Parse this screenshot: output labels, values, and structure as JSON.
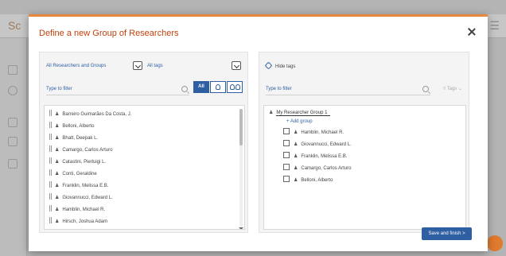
{
  "background": {
    "logo_text": "Sc",
    "menu_icon": "hamburger-icon"
  },
  "modal": {
    "title": "Define a new Group of Researchers",
    "close_icon": "close-icon"
  },
  "left_panel": {
    "group_filter": {
      "selected": "All Researchers and Groups"
    },
    "tag_filter": {
      "selected": "All tags"
    },
    "filter": {
      "placeholder": "Type to filter",
      "value": "Type to filter"
    },
    "toggle_buttons": [
      {
        "label": "All",
        "icon": "",
        "active": true
      },
      {
        "label": "",
        "icon": "person-icon",
        "active": false
      },
      {
        "label": "",
        "icon": "group-icon",
        "active": false
      }
    ],
    "researchers": [
      "Barreiro Guimarães Da Costa, J.",
      "Belloni, Alberto",
      "Bhatt, Deepak L.",
      "Camargo, Carlos Arturo",
      "Catastini, Pierluigi L.",
      "Conti, Geraldine",
      "Franklin, Melissa E.B.",
      "Giovannucci, Edward L.",
      "Hamblin, Michael R.",
      "Hirsch, Joshua Adam"
    ]
  },
  "right_panel": {
    "hide_tags_label": "Hide tags",
    "filter": {
      "placeholder": "Type to filter",
      "value": "Type to filter"
    },
    "tags_label": "Tags",
    "group": {
      "name": "My Researcher Group 1",
      "add_group_label": "+ Add group",
      "members": [
        "Hamblin, Michael R.",
        "Giovannucci, Edward L.",
        "Franklin, Melissa E.B.",
        "Camargo, Carlos Arturo",
        "Belloni, Alberto"
      ]
    }
  },
  "footer": {
    "save_label": "Save and finish  >"
  },
  "colors": {
    "accent_orange": "#e5893c",
    "title_orange": "#c2410c",
    "primary_blue": "#2e5fa3"
  }
}
